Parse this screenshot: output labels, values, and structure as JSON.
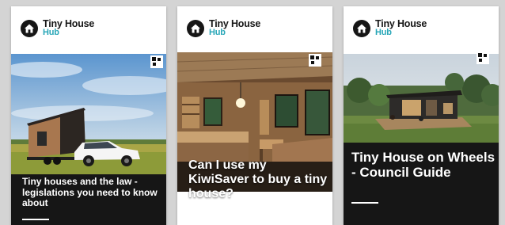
{
  "colors": {
    "brand_dark": "#161616",
    "brand_accent": "#2aa7b8",
    "background": "#d4d4d4"
  },
  "brand": {
    "name": "Tiny House",
    "sub": "Hub",
    "icon": "house-logo-icon"
  },
  "cards": [
    {
      "title": "Tiny houses and the law - legislations you need to know about",
      "image": "tiny-house-trailer-with-car-photo"
    },
    {
      "title": "Can I use my KiwiSaver to buy a tiny house?",
      "image": "tiny-house-wooden-interior-photo"
    },
    {
      "title": "Tiny House on Wheels - Council Guide",
      "image": "tiny-house-deck-forest-photo"
    }
  ]
}
